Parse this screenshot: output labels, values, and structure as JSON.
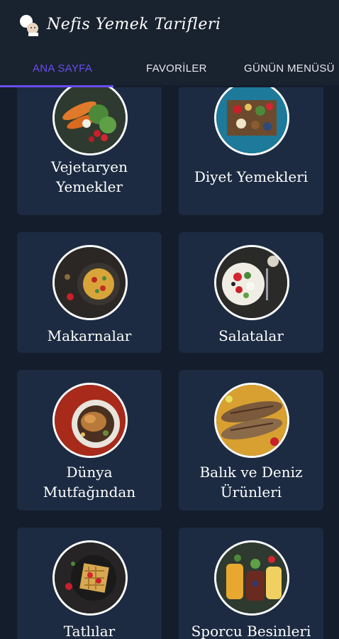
{
  "app": {
    "title": "Nefis Yemek Tarifleri",
    "logo_icon": "chef-icon"
  },
  "tabs": [
    {
      "label": "ANA SAYFA",
      "active": true
    },
    {
      "label": "FAVORİLER",
      "active": false
    },
    {
      "label": "GÜNÜN MENÜSÜ",
      "active": false
    }
  ],
  "colors": {
    "accent": "#6a4df0",
    "background": "#141d2b",
    "card": "#1c2b42"
  },
  "categories": [
    {
      "label": "Vejetaryen Yemekler",
      "line1": "Vejetaryen",
      "line2": "Yemekler",
      "icon": "vegetables-photo"
    },
    {
      "label": "Diyet Yemekleri",
      "line1": "Diyet Yemekleri",
      "line2": "",
      "icon": "diet-platter-photo"
    },
    {
      "label": "Makarnalar",
      "line1": "Makarnalar",
      "line2": "",
      "icon": "pasta-photo"
    },
    {
      "label": "Salatalar",
      "line1": "Salatalar",
      "line2": "",
      "icon": "salad-photo"
    },
    {
      "label": "Dünya Mutfağından",
      "line1": "Dünya",
      "line2": "Mutfağından",
      "icon": "roast-chicken-photo"
    },
    {
      "label": "Balık ve Deniz Ürünleri",
      "line1": "Balık ve Deniz",
      "line2": "Ürünleri",
      "icon": "grilled-fish-photo"
    },
    {
      "label": "Tatlılar",
      "line1": "Tatlılar",
      "line2": "",
      "icon": "waffle-dessert-photo"
    },
    {
      "label": "Sporcu Besinleri",
      "line1": "Sporcu Besinleri",
      "line2": "",
      "icon": "fruit-jars-photo"
    }
  ]
}
